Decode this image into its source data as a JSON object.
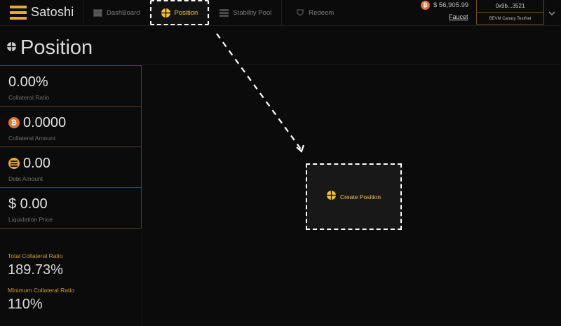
{
  "app": {
    "name": "Satoshi"
  },
  "nav": {
    "items": [
      {
        "label": "DashBoard",
        "icon": "dashboard-icon"
      },
      {
        "label": "Position",
        "icon": "position-icon",
        "active": true
      },
      {
        "label": "Stability Pool",
        "icon": "stability-pool-icon"
      },
      {
        "label": "Redeem",
        "icon": "redeem-icon"
      }
    ]
  },
  "header": {
    "btc_price": "$ 56,905.99",
    "faucet": "Faucet",
    "wallet_address": "0x9b...3521",
    "network": "BEVM Canary TestNet"
  },
  "page": {
    "title": "Position"
  },
  "stats": [
    {
      "value": "0.00%",
      "label": "Collateral Ratio"
    },
    {
      "value": "0.0000",
      "label": "Collateral Amount",
      "icon": "btc-icon"
    },
    {
      "value": "0.00",
      "label": "Debt Amount",
      "icon": "satoshi-token-icon"
    },
    {
      "value": "$ 0.00",
      "label": "Liquidation Price"
    }
  ],
  "totals": {
    "total_label": "Total Collateral Ratio",
    "total_value": "189.73%",
    "min_label": "Minimum Collateral Ratio",
    "min_value": "110%"
  },
  "actions": {
    "create_position": "Create Position"
  },
  "colors": {
    "accent": "#f5c23e",
    "brand": "#e8a93c",
    "btc": "#e2722c",
    "background": "#0b0b0b",
    "border": "#5a3e22"
  }
}
